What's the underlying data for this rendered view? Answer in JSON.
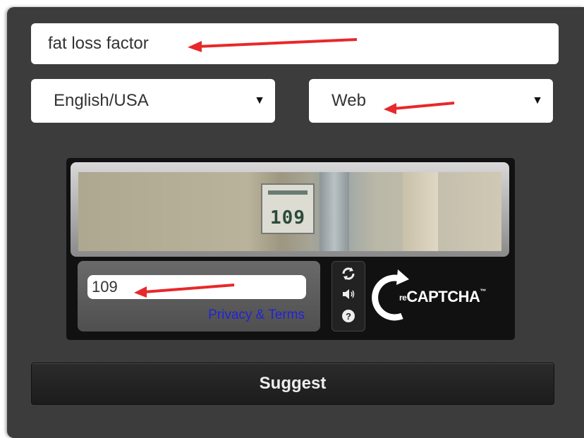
{
  "search": {
    "value": "fat loss factor"
  },
  "language_select": {
    "selected": "English/USA"
  },
  "type_select": {
    "selected": "Web"
  },
  "captcha": {
    "image_text": "109",
    "input_value": "109",
    "privacy_link": "Privacy & Terms",
    "logo": {
      "re": "re",
      "name": "CAPTCHA",
      "tm": "™"
    }
  },
  "suggest": {
    "label": "Suggest"
  },
  "colors": {
    "panel": "#3c3c3c",
    "annotation_arrow": "#e8282a",
    "link": "#2323d6"
  },
  "icons": [
    "chevron-down-icon",
    "refresh-icon",
    "audio-icon",
    "help-icon",
    "recaptcha-logo-icon",
    "annotation-arrow"
  ]
}
